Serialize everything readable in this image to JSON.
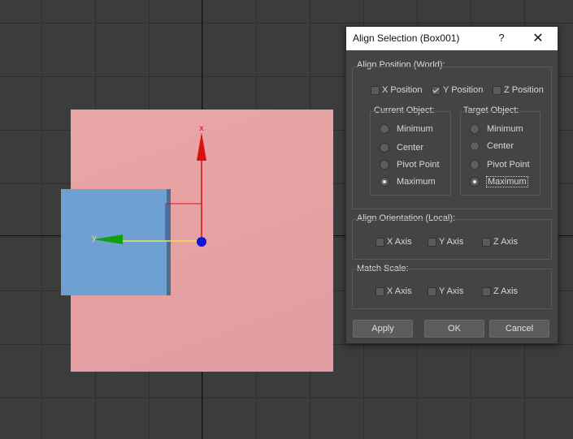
{
  "dialog": {
    "title": "Align Selection (Box001)",
    "help_label": "?",
    "close_label": "✕",
    "align_position": {
      "title": "Align Position (World):",
      "axes": [
        {
          "label": "X Position",
          "checked": false
        },
        {
          "label": "Y Position",
          "checked": true
        },
        {
          "label": "Z Position",
          "checked": false
        }
      ],
      "current_object": {
        "title": "Current Object:",
        "options": [
          "Minimum",
          "Center",
          "Pivot Point",
          "Maximum"
        ],
        "selected": "Maximum"
      },
      "target_object": {
        "title": "Target Object:",
        "options": [
          "Minimum",
          "Center",
          "Pivot Point",
          "Maximum"
        ],
        "selected": "Maximum"
      }
    },
    "align_orientation": {
      "title": "Align Orientation (Local):",
      "axes": [
        {
          "label": "X Axis",
          "checked": false
        },
        {
          "label": "Y Axis",
          "checked": false
        },
        {
          "label": "Z Axis",
          "checked": false
        }
      ]
    },
    "match_scale": {
      "title": "Match Scale:",
      "axes": [
        {
          "label": "X Axis",
          "checked": false
        },
        {
          "label": "Y Axis",
          "checked": false
        },
        {
          "label": "Z Axis",
          "checked": false
        }
      ]
    },
    "buttons": {
      "apply": "Apply",
      "ok": "OK",
      "cancel": "Cancel"
    }
  },
  "viewport": {
    "gizmo_x_label": "x",
    "gizmo_y_label": "y",
    "plane_color": "#e8a4a4",
    "box_color": "#6ea1d2",
    "gizmo_colors": {
      "x": "#e01010",
      "y": "#10a010",
      "z": "#1010d0"
    }
  }
}
